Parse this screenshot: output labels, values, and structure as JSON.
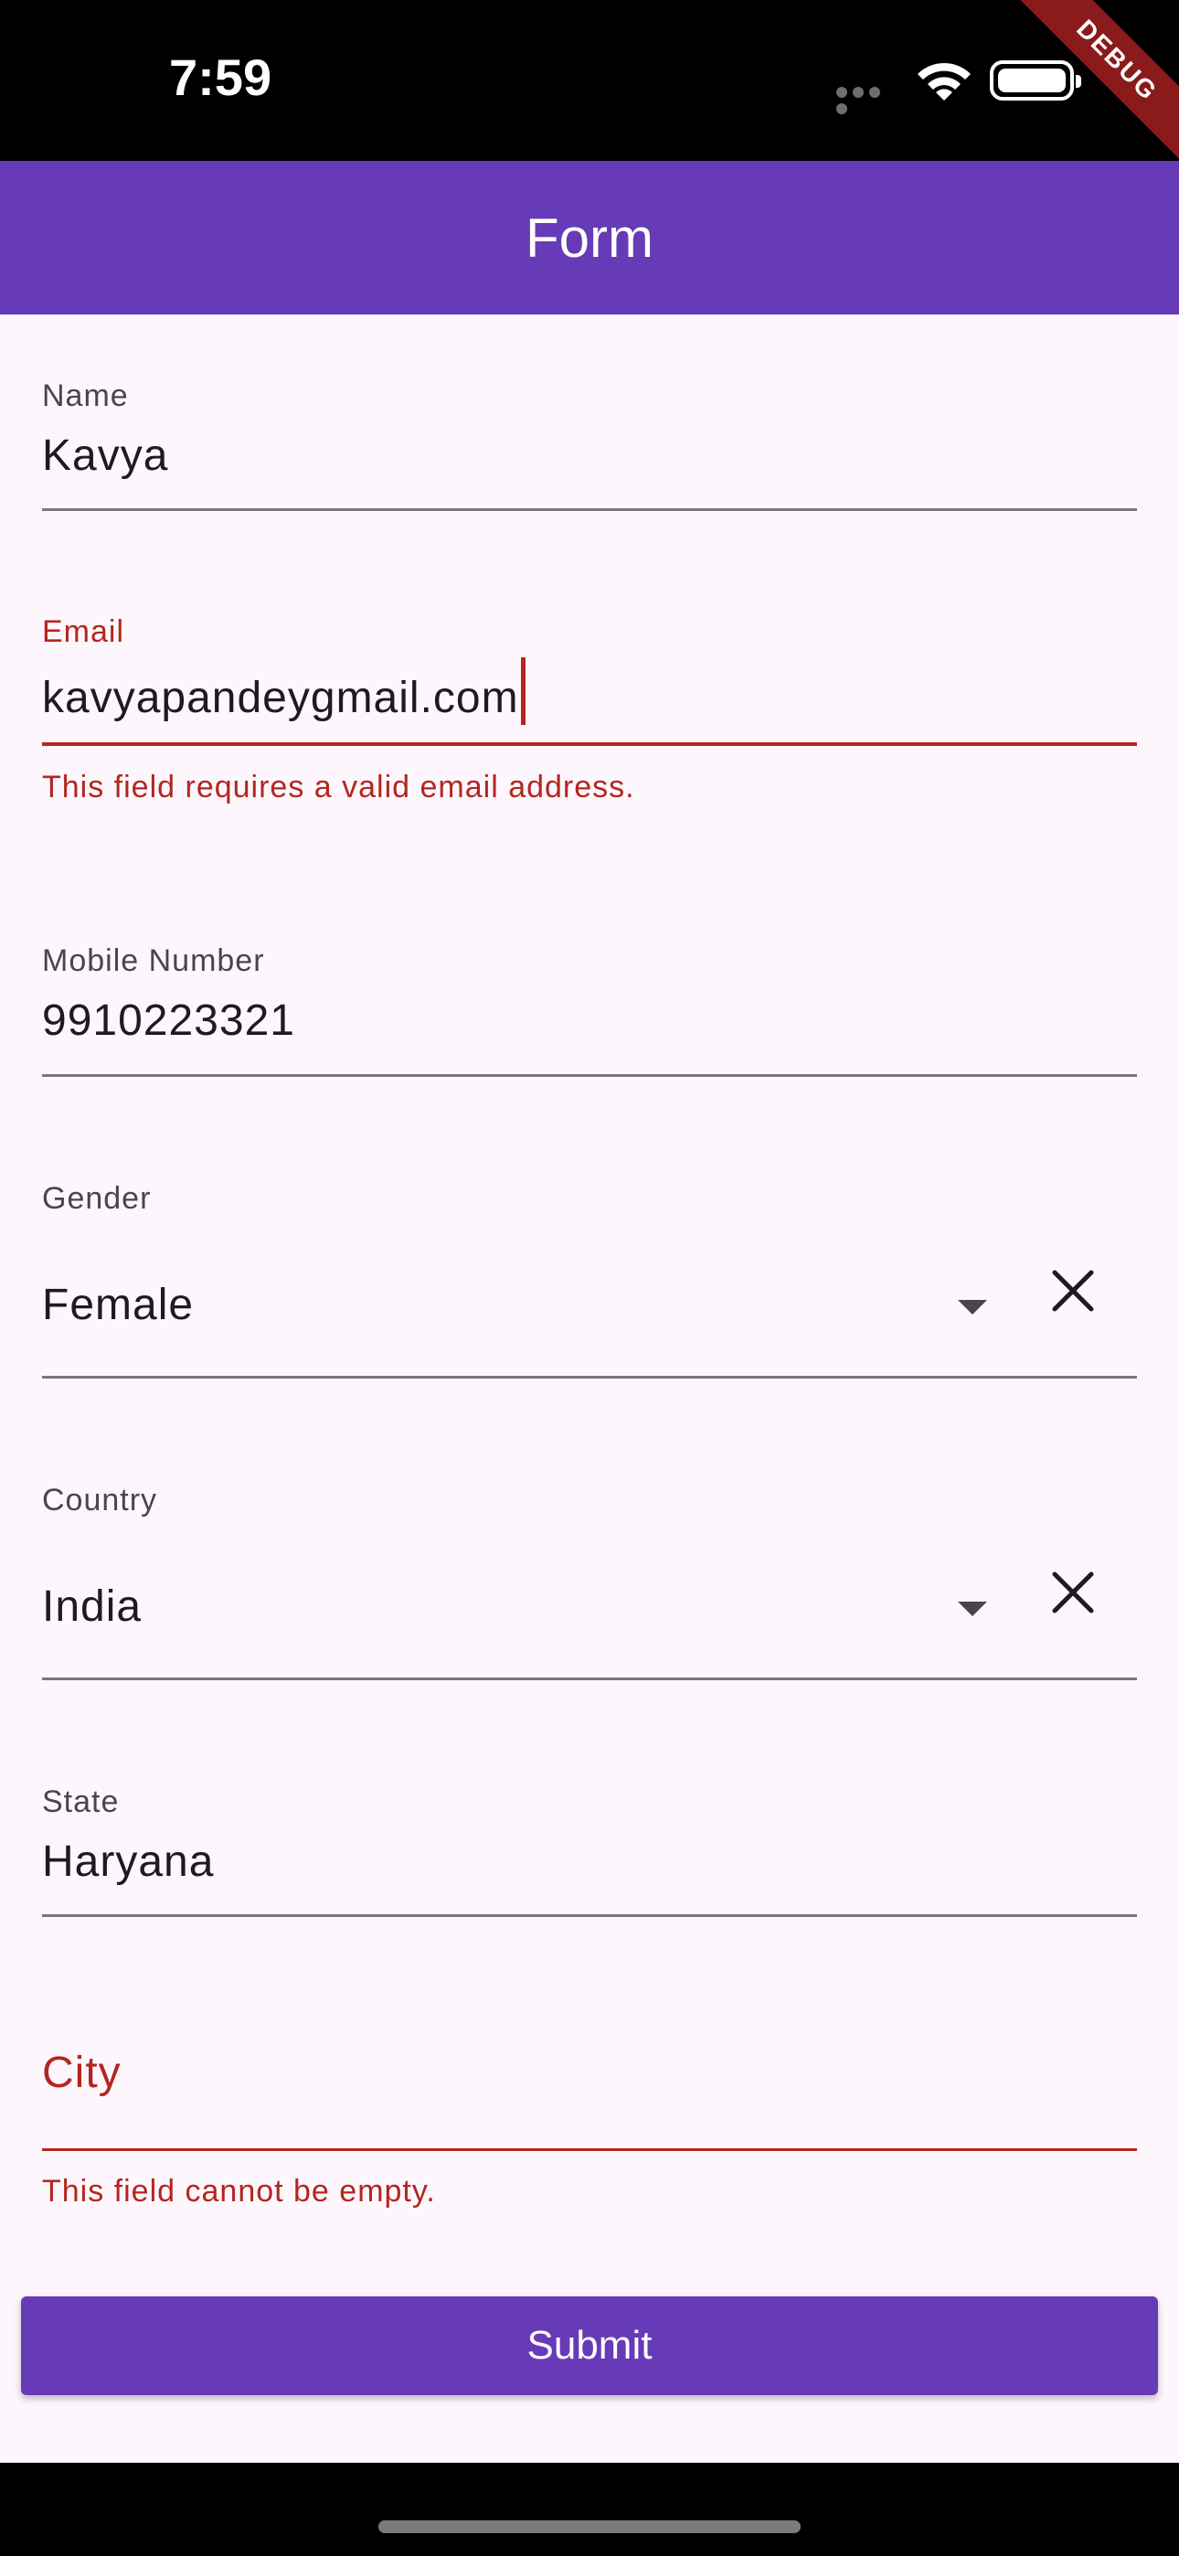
{
  "status_bar": {
    "time": "7:59",
    "debug_banner": "DEBUG"
  },
  "app_bar": {
    "title": "Form"
  },
  "form": {
    "name": {
      "label": "Name",
      "value": "Kavya"
    },
    "email": {
      "label": "Email",
      "value": "kavyapandeygmail.com",
      "error": "This field requires a valid email address."
    },
    "mobile": {
      "label": "Mobile Number",
      "value": "9910223321"
    },
    "gender": {
      "label": "Gender",
      "value": "Female"
    },
    "country": {
      "label": "Country",
      "value": "India"
    },
    "state": {
      "label": "State",
      "value": "Haryana"
    },
    "city": {
      "label": "City",
      "error": "This field cannot be empty."
    }
  },
  "submit": {
    "label": "Submit"
  },
  "colors": {
    "accent": "#673ab7",
    "error": "#b3261e",
    "background": "#fdf7fd"
  }
}
